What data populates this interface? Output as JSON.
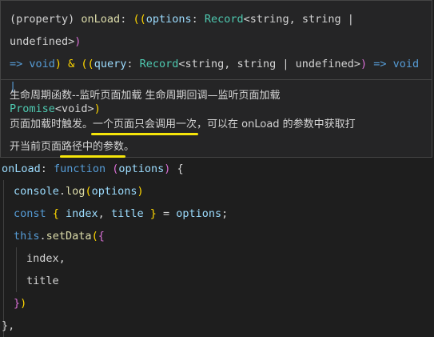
{
  "tooltip": {
    "signature": {
      "prefix": "(property) ",
      "name": "onLoad",
      "colon": ": ",
      "p1": "((",
      "param1": "options",
      "c1": ": ",
      "type1": "Record",
      "gen1": "<string, string | undefined>",
      "close1": ")",
      "arrow1": "=> void",
      "amp": ") & ",
      "p2": "((",
      "param2": "query",
      "c2": ": ",
      "type2": "Record",
      "gen2": "<string, string | undefined>",
      "close2": ")",
      "arrow2": " => void |",
      "promise": "Promise",
      "promise_gen": "<void>",
      "end": ")"
    },
    "doc_line1": "生命周期函数--监听页面加载 生命周期回调—监听页面加载",
    "doc_line2_a": "页面加载时触发。",
    "doc_line2_b": "一个页面只会调用一次",
    "doc_line2_c": "，可以在 onLoad 的参数中获取打",
    "doc_line3_a": "开当前页面",
    "doc_line3_b": "路径中的参数",
    "doc_line3_c": "。"
  },
  "code": {
    "l1_name": "onLoad",
    "l1_colon": ": ",
    "l1_kw": "function",
    "l1_open": " (",
    "l1_param": "options",
    "l1_close": ")",
    "l1_brace": " {",
    "l2_obj": "console",
    "l2_dot": ".",
    "l2_fn": "log",
    "l2_open": "(",
    "l2_arg": "options",
    "l2_close": ")",
    "l3_kw": "const",
    "l3_open": " { ",
    "l3_a": "index",
    "l3_comma": ", ",
    "l3_b": "title",
    "l3_close": " }",
    "l3_eq": " = ",
    "l3_src": "options",
    "l3_semi": ";",
    "l4_this": "this",
    "l4_dot": ".",
    "l4_fn": "setData",
    "l4_open": "(",
    "l4_brace": "{",
    "l5": "index,",
    "l6": "title",
    "l7_brace": "}",
    "l7_paren": ")",
    "l8": "},"
  }
}
